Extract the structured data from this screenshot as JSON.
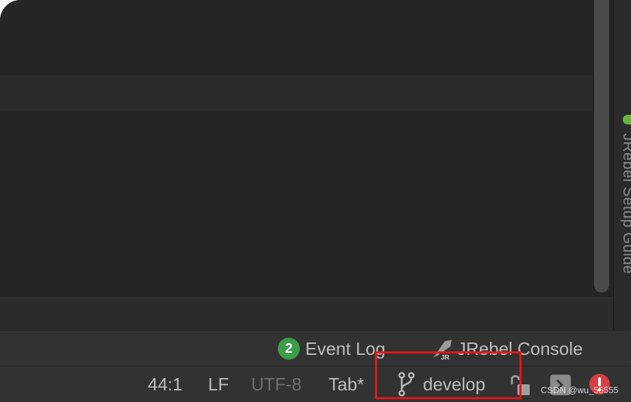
{
  "sidebar_right": {
    "jrebel_tab_label": "JRebel Setup Guide"
  },
  "toolbar": {
    "event_log_count": "2",
    "event_log_label": "Event Log",
    "jrebel_console_label": "JRebel Console"
  },
  "status_bar": {
    "position": "44:1",
    "line_separator": "LF",
    "encoding": "UTF-8",
    "indent": "Tab*",
    "branch": "develop"
  },
  "watermark": "CSDN @wu_55555",
  "colors": {
    "badge_green": "#3c9e48",
    "highlight_red": "#e8151b",
    "error_red": "#d64045",
    "jrebel_green": "#6cb33f"
  },
  "icons": {
    "branch": "git-branch-icon",
    "lock": "unlocked-padlock-icon",
    "terminal": "terminal-prompt-icon",
    "error": "error-exclamation-icon",
    "jrebel": "jrebel-rocket-icon"
  }
}
